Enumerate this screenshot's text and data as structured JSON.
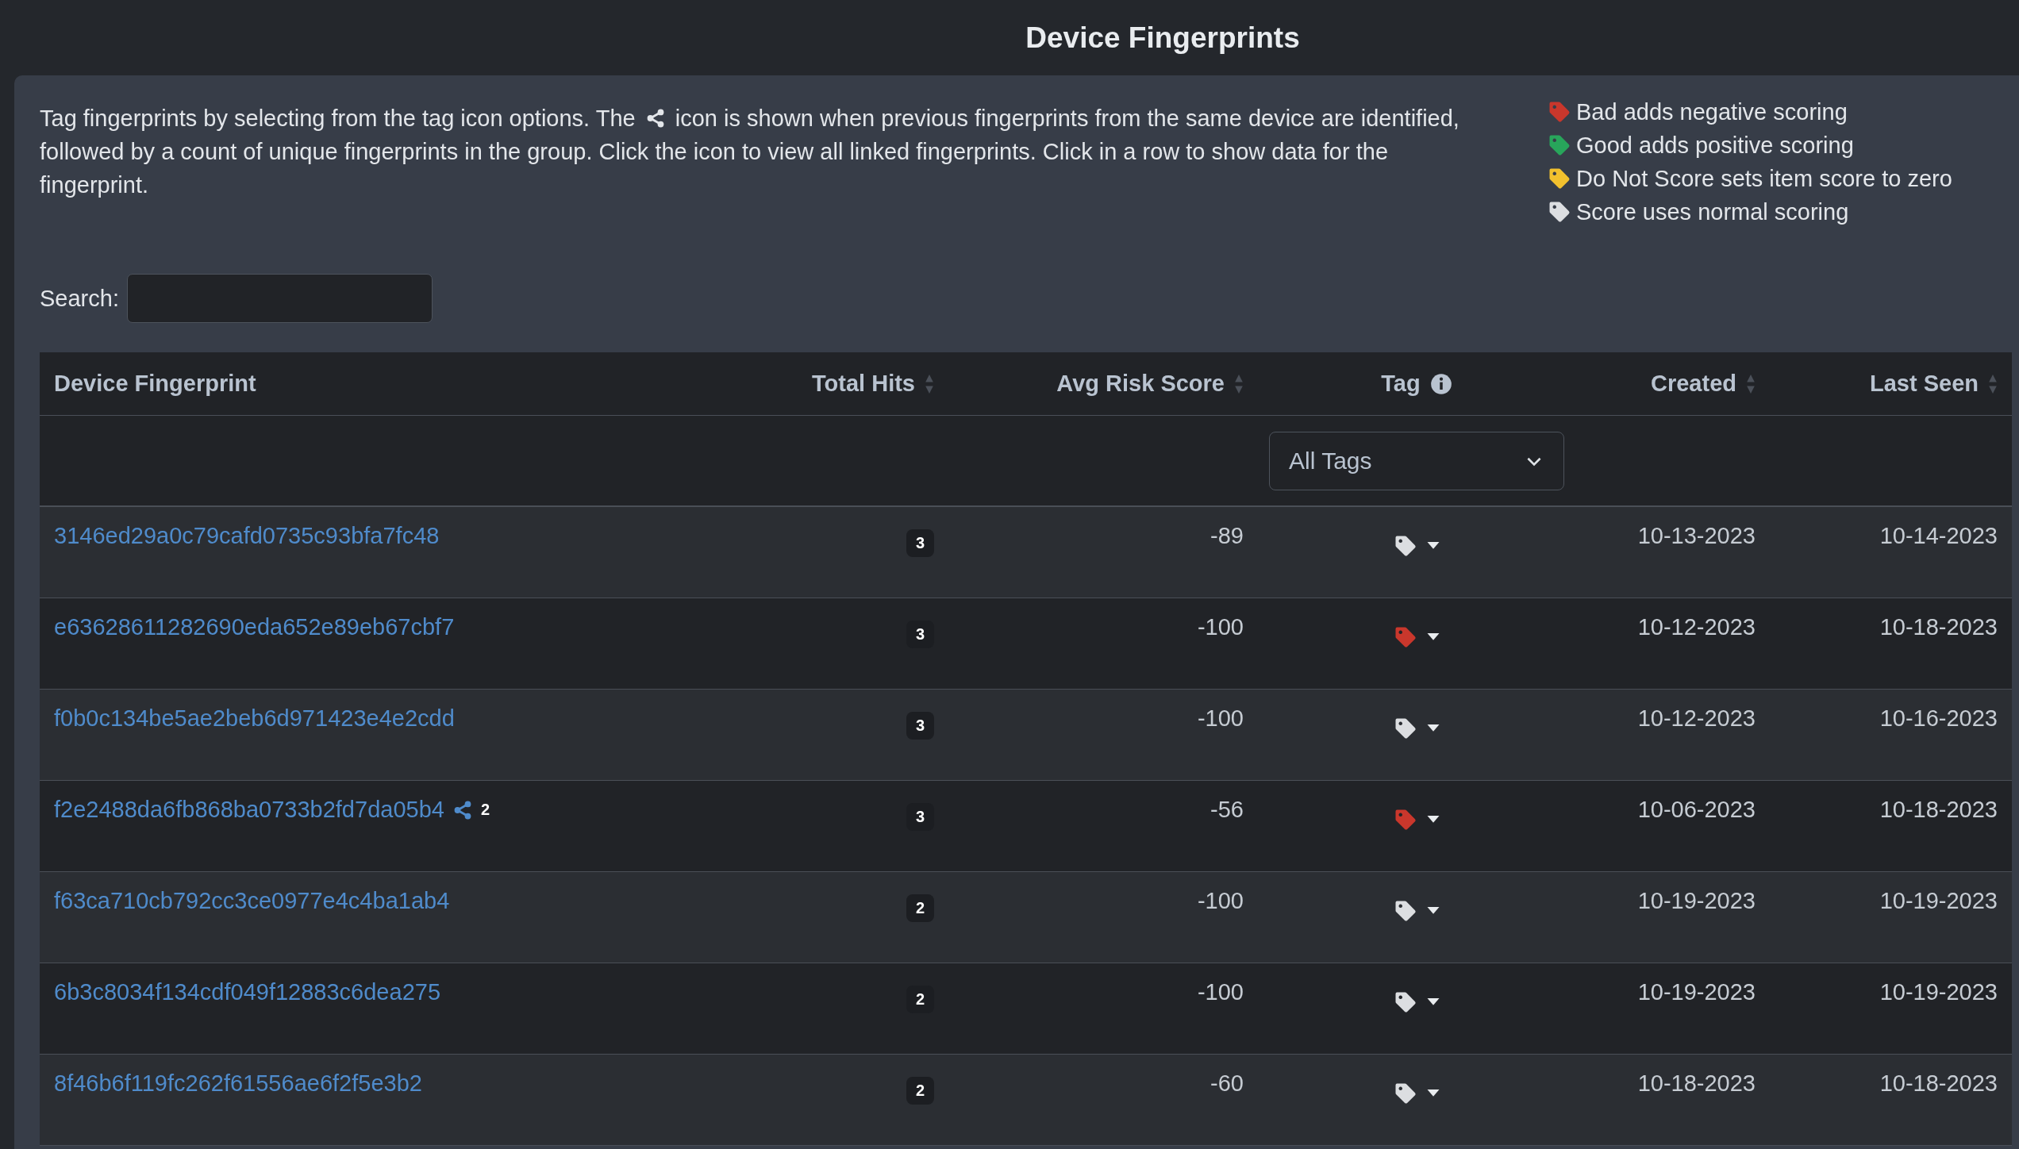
{
  "title": "Device Fingerprints",
  "intro": {
    "text_before": "Tag fingerprints by selecting from the tag icon options. The",
    "text_after": "icon is shown when previous fingerprints from the same device are identified, followed by a count of unique fingerprints in the group. Click the icon to view all linked fingerprints. Click in a row to show data for the fingerprint."
  },
  "legend": [
    {
      "text": "Bad adds negative scoring",
      "color": "#c9372c"
    },
    {
      "text": "Good adds positive scoring",
      "color": "#28a55b"
    },
    {
      "text": "Do Not Score sets item score to zero",
      "color": "#f2c12e"
    },
    {
      "text": "Score uses normal scoring",
      "color": "#dcdee1"
    }
  ],
  "search": {
    "label": "Search:"
  },
  "table": {
    "columns": [
      {
        "label": "Device Fingerprint",
        "sortable": false,
        "info": false
      },
      {
        "label": "Total Hits",
        "sortable": true,
        "info": false
      },
      {
        "label": "Avg Risk Score",
        "sortable": true,
        "info": false
      },
      {
        "label": "Tag",
        "sortable": false,
        "info": true
      },
      {
        "label": "Created",
        "sortable": true,
        "info": false
      },
      {
        "label": "Last Seen",
        "sortable": true,
        "info": false
      }
    ],
    "tag_filter": "All Tags",
    "rows": [
      {
        "fingerprint": "3146ed29a0c79cafd0735c93bfa7fc48",
        "hits": "3",
        "avg_risk": "-89",
        "color": "#dcdee1",
        "created": "10-13-2023",
        "last_seen": "10-14-2023"
      },
      {
        "fingerprint": "e63628611282690eda652e89eb67cbf7",
        "hits": "3",
        "avg_risk": "-100",
        "color": "#c9372c",
        "created": "10-12-2023",
        "last_seen": "10-18-2023"
      },
      {
        "fingerprint": "f0b0c134be5ae2beb6d971423e4e2cdd",
        "hits": "3",
        "avg_risk": "-100",
        "color": "#dcdee1",
        "created": "10-12-2023",
        "last_seen": "10-16-2023"
      },
      {
        "fingerprint": "f2e2488da6fb868ba0733b2fd7da05b4",
        "linked_count": "2",
        "hits": "3",
        "avg_risk": "-56",
        "color": "#c9372c",
        "created": "10-06-2023",
        "last_seen": "10-18-2023"
      },
      {
        "fingerprint": "f63ca710cb792cc3ce0977e4c4ba1ab4",
        "hits": "2",
        "avg_risk": "-100",
        "color": "#dcdee1",
        "created": "10-19-2023",
        "last_seen": "10-19-2023"
      },
      {
        "fingerprint": "6b3c8034f134cdf049f12883c6dea275",
        "hits": "2",
        "avg_risk": "-100",
        "color": "#dcdee1",
        "created": "10-19-2023",
        "last_seen": "10-19-2023"
      },
      {
        "fingerprint": "8f46b6f119fc262f61556ae6f2f5e3b2",
        "hits": "2",
        "avg_risk": "-60",
        "color": "#dcdee1",
        "created": "10-18-2023",
        "last_seen": "10-18-2023"
      }
    ]
  }
}
